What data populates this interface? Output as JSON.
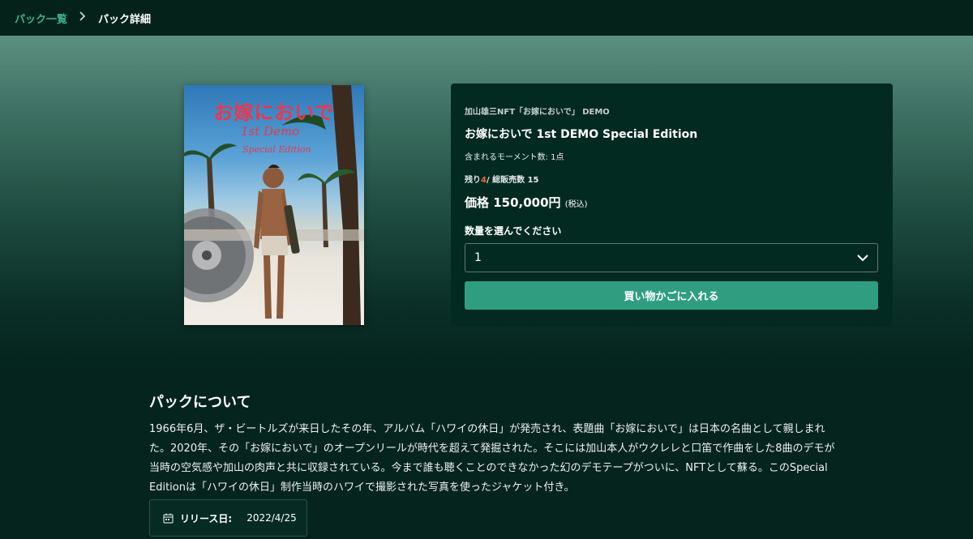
{
  "breadcrumb": {
    "parent_label": "パック一覧",
    "separator_icon": "chevron-right-icon",
    "current_label": "パック詳細"
  },
  "cover": {
    "title": "お嫁においで",
    "subtitle": "1st Demo",
    "edition": "Special Edition"
  },
  "pack": {
    "artist_line": "加山雄三NFT「お嫁においで」 DEMO",
    "name": "お嫁においで 1st DEMO Special Edition",
    "moments_text": "含まれるモーメント数: 1点",
    "stock_prefix": "残り",
    "remaining": "4",
    "stock_suffix": "/ 総販売数 15",
    "price_text": "価格 150,000円",
    "tax_note": "(税込)",
    "quantity_label": "数量を選んでください",
    "quantity_value": "1",
    "quantity_icon": "chevron-down-icon",
    "cart_button_label": "買い物かごに入れる"
  },
  "about": {
    "title": "パックについて",
    "body": "1966年6月、ザ・ビートルズが来日したその年、アルバム「ハワイの休日」が発売され、表題曲「お嫁においで」は日本の名曲として親しまれた。2020年、その「お嫁においで」のオープンリールが時代を超えて発掘された。そこには加山本人がウクレレと口笛で作曲をした8曲のデモが当時の空気感や加山の肉声と共に収録されている。今まで誰も聴くことのできなかった幻のデモテープがついに、NFTとして蘇る。このSpecial Editionは「ハワイの休日」制作当時のハワイで撮影された写真を使ったジャケット付き。"
  },
  "release": {
    "icon": "calendar-icon",
    "label": "リリース日:",
    "date": "2022/4/25"
  },
  "colors": {
    "accent": "#2f9e80",
    "breadcrumb_link": "#3bb08f",
    "panel_bg": "#032a21",
    "page_bg": "#04241d",
    "remaining_highlight": "#e86a3a"
  }
}
